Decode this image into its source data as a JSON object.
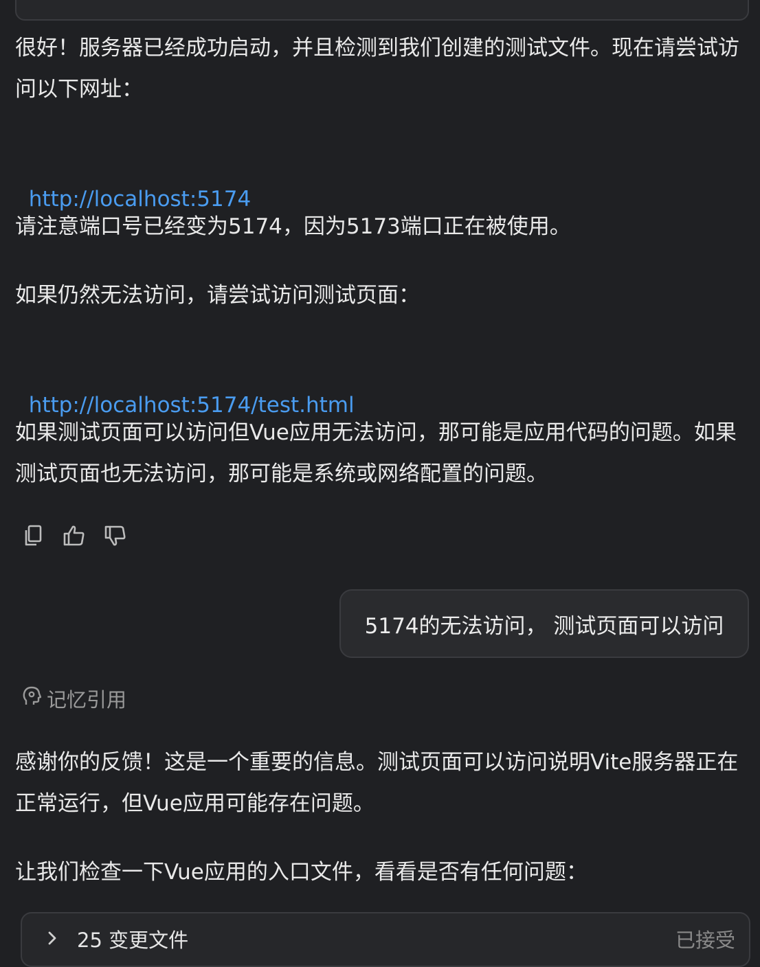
{
  "messages": {
    "assistant_1": {
      "p1": "很好！服务器已经成功启动，并且检测到我们创建的测试文件。现在请尝试访问以下网址：",
      "link1": "http://localhost:5174",
      "p2": "请注意端口号已经变为5174，因为5173端口正在被使用。",
      "p3": "如果仍然无法访问，请尝试访问测试页面：",
      "link2": "http://localhost:5174/test.html",
      "p4": "如果测试页面可以访问但Vue应用无法访问，那可能是应用代码的问题。如果测试页面也无法访问，那可能是系统或网络配置的问题。"
    },
    "user": {
      "text": "5174的无法访问， 测试页面可以访问"
    },
    "memory": {
      "label": "记忆引用"
    },
    "assistant_2": {
      "p1": "感谢你的反馈！这是一个重要的信息。测试页面可以访问说明Vite服务器正在正常运行，但Vue应用可能存在问题。",
      "p2": "让我们检查一下Vue应用的入口文件，看看是否有任何问题："
    }
  },
  "files_panel": {
    "label": "25 变更文件",
    "status": "已接受"
  },
  "icons": [
    "copy-icon",
    "thumbs-up-icon",
    "thumbs-down-icon",
    "memory-icon",
    "chevron-right-icon"
  ],
  "colors": {
    "background": "#1f2023",
    "link": "#4a9cf0",
    "muted": "#9a9a9a"
  }
}
